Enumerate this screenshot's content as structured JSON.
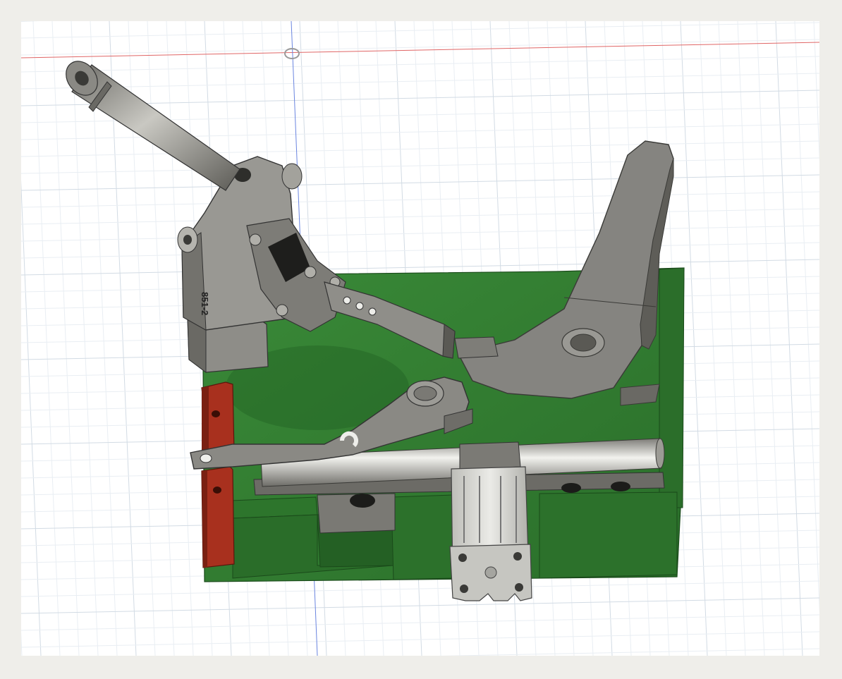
{
  "viewport": {
    "background": "#ffffff",
    "grid_minor_color": "#e9eef3",
    "grid_major_color": "#d2dbe4",
    "x_axis_color": "#e05a5a",
    "y_axis_color": "#5a78e0"
  },
  "model": {
    "clamp_part_label": "851-2",
    "colors": {
      "base_plate": "#2f7a2f",
      "base_plate_dark": "#1f5a20",
      "steel": "#8a8a84",
      "steel_light": "#b8b7b0",
      "steel_dark": "#55544f",
      "red_block": "#a8301e",
      "cylinder_body": "#d6d6d2"
    }
  },
  "icons": {
    "origin": "origin-marker-icon"
  }
}
